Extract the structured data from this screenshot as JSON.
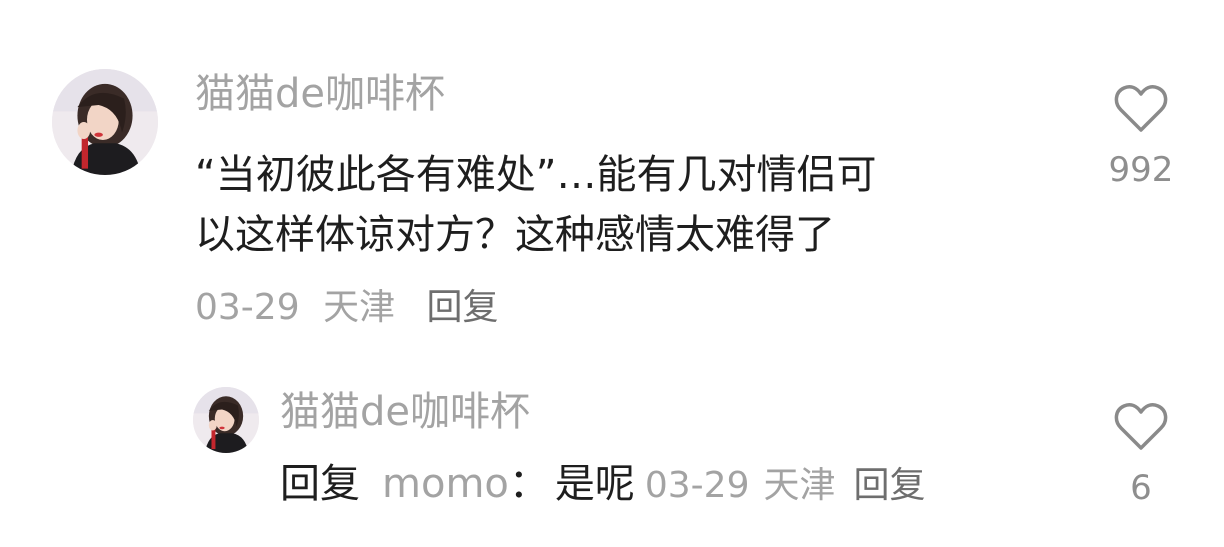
{
  "comment": {
    "username": "猫猫de咖啡杯",
    "text_line1": "“当初彼此各有难处”…能有几对情侣可",
    "text_line2": "以这样体谅对方？这种感情太难得了",
    "date": "03-29",
    "location": "天津",
    "reply_label": "回复",
    "like_count": "992",
    "like_icon": "heart-outline-icon",
    "avatar_icon": "user-avatar"
  },
  "reply": {
    "username": "猫猫de咖啡杯",
    "prefix": "回复",
    "target_user": "momo",
    "colon": "：",
    "text": "是呢",
    "date": "03-29",
    "location": "天津",
    "reply_label": "回复",
    "like_count": "6",
    "like_icon": "heart-outline-icon",
    "avatar_icon": "user-avatar"
  },
  "colors": {
    "username": "#a3a3a3",
    "text": "#1e1e1e",
    "icon": "#8a8a8a"
  }
}
